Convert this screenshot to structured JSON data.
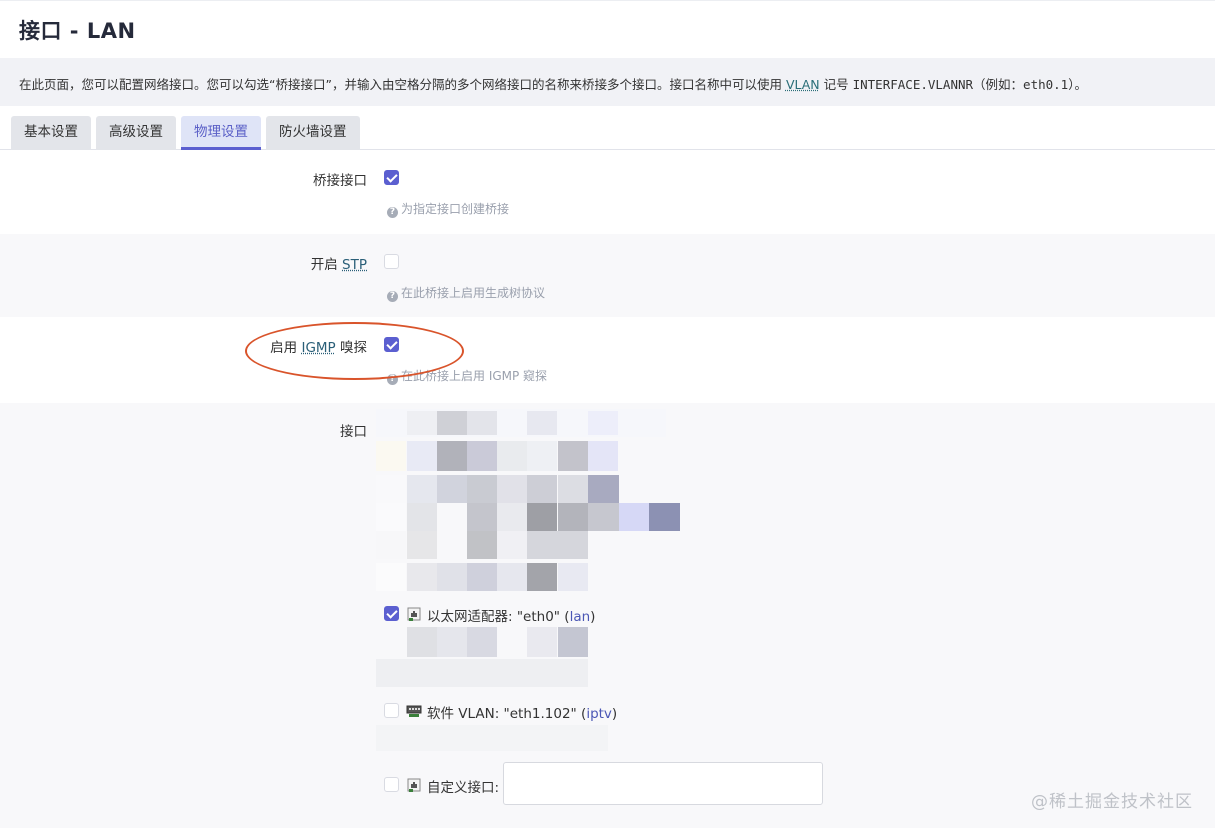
{
  "title": "接口 - LAN",
  "description": {
    "prefix": "在此页面，您可以配置网络接口。您可以勾选“桥接接口”，并输入由空格分隔的多个网络接口的名称来桥接多个接口。接口名称中可以使用 ",
    "vlan_link": "VLAN",
    "middle": " 记号 ",
    "notation": "INTERFACE.VLANNR",
    "example_open": "（例如：",
    "example_value": "eth0.1",
    "example_close": "）。"
  },
  "tabs": [
    {
      "label": "基本设置",
      "active": false
    },
    {
      "label": "高级设置",
      "active": false
    },
    {
      "label": "物理设置",
      "active": true
    },
    {
      "label": "防火墙设置",
      "active": false
    }
  ],
  "fields": {
    "bridge": {
      "label": "桥接接口",
      "checked": true,
      "hint": "为指定接口创建桥接"
    },
    "stp": {
      "label_prefix": "开启 ",
      "label_abbr": "STP",
      "checked": false,
      "hint": "在此桥接上启用生成树协议"
    },
    "igmp": {
      "label_prefix": "启用 ",
      "label_abbr": "IGMP",
      "label_suffix": " 嗅探",
      "checked": true,
      "hint": "在此桥接上启用 IGMP 窥探"
    },
    "interfaces": {
      "label": "接口",
      "items": [
        {
          "prefix": "以太网适配器: \"eth0\" (",
          "zone": "lan",
          "suffix": ")",
          "checked": true,
          "icon": "ethernet-port-icon"
        },
        {
          "prefix": "软件 VLAN: \"eth1.102\" (",
          "zone": "iptv",
          "suffix": ")",
          "checked": false,
          "icon": "vlan-switch-icon"
        },
        {
          "prefix": "自定义接口:",
          "zone": "",
          "suffix": "",
          "checked": false,
          "icon": "ethernet-port-icon"
        }
      ],
      "custom_value": ""
    }
  },
  "watermark": "@稀土掘金技术社区",
  "colors": {
    "accent": "#5b5fd0",
    "annotation": "#d9542b",
    "zone": "#4b57b5"
  }
}
